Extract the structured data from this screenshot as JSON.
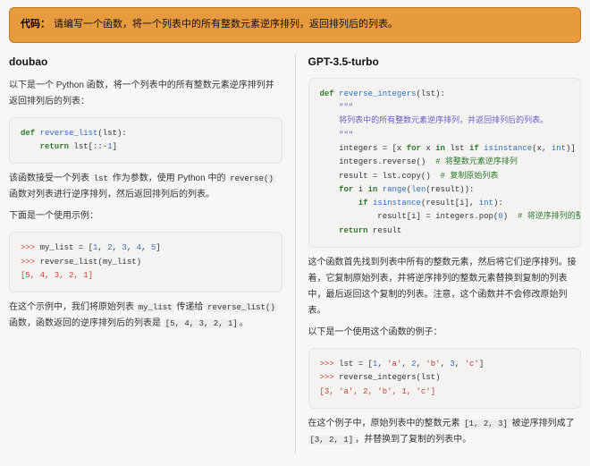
{
  "banner": {
    "label": "代码：",
    "text": "请编写一个函数，将一个列表中的所有整数元素逆序排列，返回排列后的列表。"
  },
  "left": {
    "model": "doubao",
    "intro": "以下是一个 Python 函数，将一个列表中的所有整数元素逆序排列并返回排列后的列表：",
    "code1_raw": "def reverse_list(lst):\n    return lst[::-1]",
    "code1_html": "<span class=\"kw\">def</span> <span class=\"fn\">reverse_list</span>(lst):\n    <span class=\"kw\">return</span> lst[::-<span class=\"num\">1</span>]",
    "explain1_a": "该函数接受一个列表 ",
    "explain1_code_lst": "lst",
    "explain1_b": " 作为参数，使用 Python 中的 ",
    "explain1_code_rev": "reverse()",
    "explain1_c": " 函数对列表进行逆序排列，然后返回排列后的列表。",
    "example_intro": "下面是一个使用示例：",
    "code2_raw": ">>> my_list = [1, 2, 3, 4, 5]\n>>> reverse_list(my_list)\n[5, 4, 3, 2, 1]",
    "code2_html": "<span class=\"prm\">&gt;&gt;&gt;</span> my_list = [<span class=\"num\">1</span>, <span class=\"num\">2</span>, <span class=\"num\">3</span>, <span class=\"num\">4</span>, <span class=\"num\">5</span>]\n<span class=\"prm\">&gt;&gt;&gt;</span> reverse_list(my_list)\n<span class=\"prm\">[5, 4, 3, 2, 1]</span>",
    "closing_a": "在这个示例中，我们将原始列表 ",
    "closing_code_mylist": "my_list",
    "closing_b": " 传递给 ",
    "closing_code_fn": "reverse_list()",
    "closing_c": " 函数，函数返回的逆序排列后的列表是 ",
    "closing_code_out": "[5, 4, 3, 2, 1]",
    "closing_d": "。"
  },
  "right": {
    "model": "GPT-3.5-turbo",
    "code1_raw": "def reverse_integers(lst):\n    \"\"\"\n    将列表中的所有整数元素逆序排列，并返回排列后的列表。\n    \"\"\"\n    integers = [x for x in lst if isinstance(x, int)]  # 找出\n    integers.reverse()  # 将整数元素逆序排列\n    result = lst.copy()  # 复制原始列表\n    for i in range(len(result)):\n        if isinstance(result[i], int):\n            result[i] = integers.pop(0)  # 将逆序排列的整数元\n    return result",
    "code1_html": "<span class=\"kw\">def</span> <span class=\"fn\">reverse_integers</span>(lst):\n    <span class=\"doc\">\"\"\"</span>\n    <span class=\"doc\">将列表中的所有整数元素逆序排列，并返回排列后的列表。</span>\n    <span class=\"doc\">\"\"\"</span>\n    integers = [x <span class=\"kw\">for</span> x <span class=\"kw\">in</span> lst <span class=\"kw\">if</span> <span class=\"tbi\">isinstance</span>(x, <span class=\"tbi\">int</span>)]  <span class=\"cmt\"># 找</span>\n    integers.reverse()  <span class=\"cmt\"># 将整数元素逆序排列</span>\n    result = lst.copy()  <span class=\"cmt\"># 复制原始列表</span>\n    <span class=\"kw\">for</span> i <span class=\"kw\">in</span> <span class=\"tbi\">range</span>(<span class=\"tbi\">len</span>(result)):\n        <span class=\"kw\">if</span> <span class=\"tbi\">isinstance</span>(result[i], <span class=\"tbi\">int</span>):\n            result[i] = integers.pop(<span class=\"num\">0</span>)  <span class=\"cmt\"># 将逆序排列的整数元</span>\n    <span class=\"kw\">return</span> result",
    "explain": "这个函数首先找到列表中所有的整数元素，然后将它们逆序排列。接着，它复制原始列表，并将逆序排列的整数元素替换到复制的列表中，最后返回这个复制的列表。注意，这个函数并不会修改原始列表。",
    "example_intro": "以下是一个使用这个函数的例子：",
    "code2_raw": ">>> lst = [1, 'a', 2, 'b', 3, 'c']\n>>> reverse_integers(lst)\n[3, 'a', 2, 'b', 1, 'c']",
    "code2_html": "<span class=\"prm\">&gt;&gt;&gt;</span> lst = [<span class=\"num\">1</span>, <span class=\"str\">'a'</span>, <span class=\"num\">2</span>, <span class=\"str\">'b'</span>, <span class=\"num\">3</span>, <span class=\"str\">'c'</span>]\n<span class=\"prm\">&gt;&gt;&gt;</span> reverse_integers(lst)\n<span class=\"prm\">[3, 'a', 2, 'b', 1, 'c']</span>",
    "closing_a": "在这个例子中，原始列表中的整数元素 ",
    "closing_code_in": "[1, 2, 3]",
    "closing_b": " 被逆序排列成了 ",
    "closing_code_out": "[3, 2, 1]",
    "closing_c": "，并替换到了复制的列表中。"
  }
}
